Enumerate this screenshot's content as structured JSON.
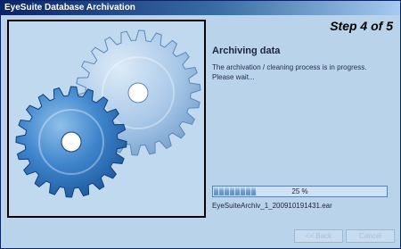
{
  "window": {
    "title": "EyeSuite Database Archivation"
  },
  "header": {
    "step": "Step 4 of 5"
  },
  "content": {
    "title": "Archiving data",
    "description_lines": [
      "The archivation / cleaning process is in progress.",
      "Please wait..."
    ]
  },
  "progress": {
    "value": 0.25,
    "label": "25 %"
  },
  "file": {
    "name": "EyeSuiteArchiv_1_200910191431.ear"
  },
  "buttons": {
    "back": "<< Back",
    "cancel": "Cancel"
  },
  "colors": {
    "background": "#b9d3ea",
    "gear_dark": "#1f5fa8",
    "gear_light": "#8db4de",
    "title_bar": "#0a246a"
  },
  "icons": [
    "gear-large-icon",
    "gear-small-icon"
  ]
}
